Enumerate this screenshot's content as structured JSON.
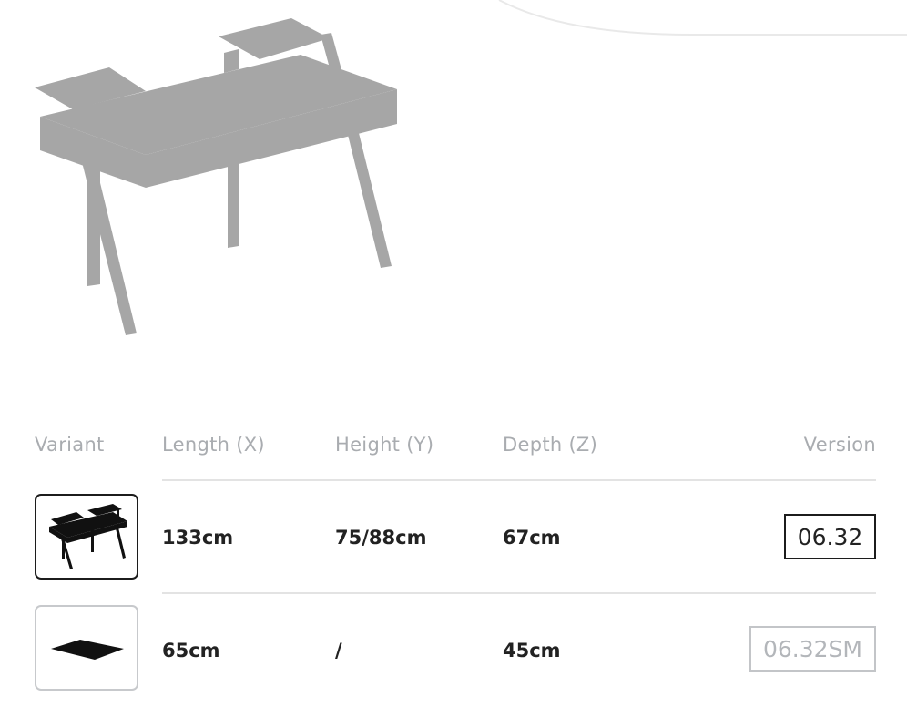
{
  "table": {
    "headers": {
      "variant": "Variant",
      "length": "Length (X)",
      "height": "Height (Y)",
      "depth": "Depth (Z)",
      "version": "Version"
    },
    "rows": [
      {
        "variant_icon": "desk-icon",
        "length": "133cm",
        "height": "75/88cm",
        "depth": "67cm",
        "version": "06.32",
        "selected": true
      },
      {
        "variant_icon": "desk-mat-icon",
        "length": "65cm",
        "height": "/",
        "depth": "45cm",
        "version": "06.32SM",
        "selected": false
      }
    ]
  },
  "colors": {
    "product_gray": "#a6a6a6",
    "accent_dark": "#1c1c1c",
    "muted_text": "#a9acb0",
    "divider": "#e3e3e3"
  }
}
